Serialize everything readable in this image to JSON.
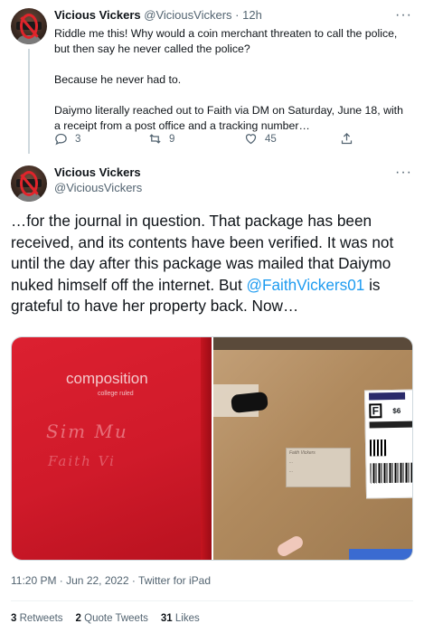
{
  "tweet1": {
    "name": "Vicious Vickers",
    "handle": "@ViciousVickers",
    "separator": "·",
    "time": "12h",
    "paragraphs": [
      "Riddle me this! Why would a coin merchant threaten to call the police, but then say he never called the police?",
      "Because he never had to.",
      "Daiymo literally reached out to Faith via DM on Saturday, June 18, with a receipt from a post office and a tracking number…"
    ],
    "replies": "3",
    "retweets": "9",
    "likes": "45"
  },
  "tweet2": {
    "name": "Vicious Vickers",
    "handle": "@ViciousVickers",
    "text_before": "…for the journal in question. That package has been received, and its contents have been verified. It was not until the day after this package was mailed that Daiymo nuked himself off the internet. But ",
    "mention": "@FaithVickers01",
    "text_after": " is grateful to have her property back. Now…",
    "media": {
      "notebook_title": "composition",
      "notebook_subtitle": "college ruled",
      "notebook_scrawl_1": "Sim Mu",
      "notebook_scrawl_2": "Faith Vi",
      "label_class": "F",
      "label_price": "$6",
      "address_lines": [
        "Faith Vickers",
        "...",
        "..."
      ]
    },
    "time": "11:20 PM · Jun 22, 2022 · Twitter for iPad",
    "stats": {
      "retweets_count": "3",
      "retweets_label": "Retweets",
      "quotes_count": "2",
      "quotes_label": "Quote Tweets",
      "likes_count": "31",
      "likes_label": "Likes"
    }
  },
  "colors": {
    "accent": "#1d9bf0",
    "muted": "#536471",
    "text": "#0f1419",
    "divider": "#eff3f4"
  },
  "icons": {
    "more": "more-icon",
    "reply": "reply-icon",
    "retweet": "retweet-icon",
    "like": "heart-icon",
    "share": "share-icon"
  }
}
